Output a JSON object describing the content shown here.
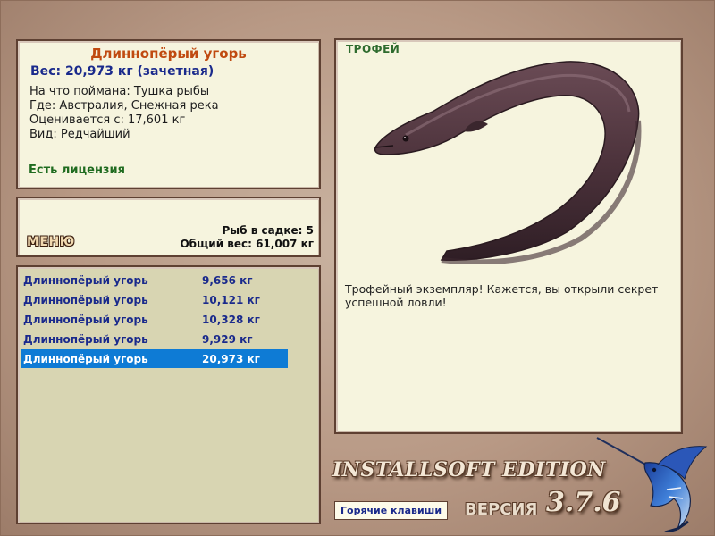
{
  "fish": {
    "name": "Длиннопёрый угорь",
    "weight_line": "Вес: 20,973 кг (зачетная)",
    "bait": "На что поймана: Тушка рыбы",
    "location": "Где: Австралия, Снежная река",
    "min_weight": "Оценивается с: 17,601 кг",
    "rarity": "Вид: Редчайший",
    "license": "Есть лицензия"
  },
  "cage": {
    "menu_label": "МЕНЮ",
    "count": "Рыб в садке: 5",
    "total": "Общий вес: 61,007 кг"
  },
  "catch_list": [
    {
      "name": "Длиннопёрый угорь",
      "weight": "9,656 кг",
      "selected": false
    },
    {
      "name": "Длиннопёрый угорь",
      "weight": "10,121 кг",
      "selected": false
    },
    {
      "name": "Длиннопёрый угорь",
      "weight": "10,328 кг",
      "selected": false
    },
    {
      "name": "Длиннопёрый угорь",
      "weight": "9,929 кг",
      "selected": false
    },
    {
      "name": "Длиннопёрый угорь",
      "weight": "20,973 кг",
      "selected": true
    }
  ],
  "trophy": {
    "label": "ТРОФЕЙ",
    "text": "Трофейный экземпляр! Кажется, вы открыли секрет успешной ловли!",
    "image_icon": "eel-image"
  },
  "footer": {
    "brand": "INSTALLSOFT EDITION",
    "version_word": "ВЕРСИЯ",
    "version_number": "3.7.6",
    "hotkeys": "Горячие клавиши",
    "logo_icon": "marlin-icon"
  },
  "colors": {
    "title": "#c04a10",
    "weight": "#1a2a8c",
    "license": "#1f6b1f",
    "selection": "#0e7bd5",
    "panel_bg": "#f6f4de",
    "list_bg": "#d8d5b2"
  }
}
